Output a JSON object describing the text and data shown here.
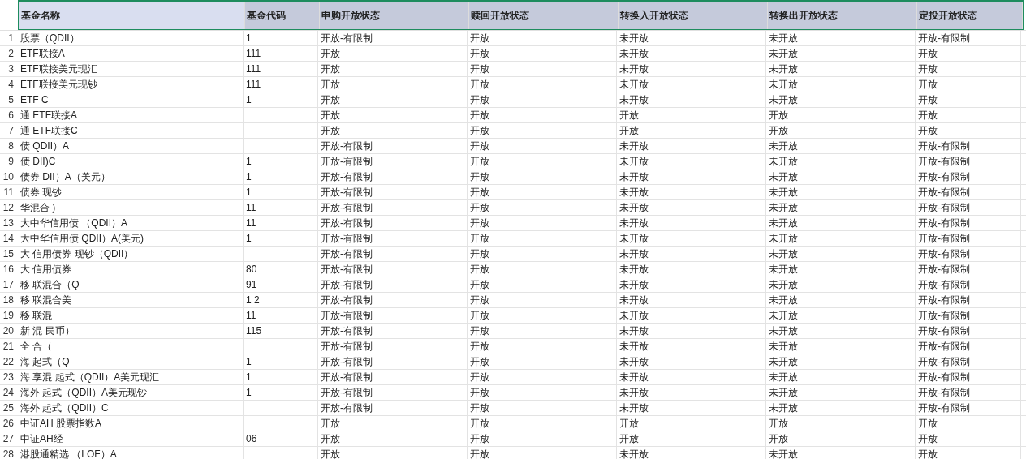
{
  "table": {
    "columns": [
      "基金名称",
      "基金代码",
      "申购开放状态",
      "赎回开放状态",
      "转换入开放状态",
      "转换出开放状态",
      "定投开放状态"
    ],
    "rows": [
      {
        "num": "1",
        "cells": [
          "股票（QDII）",
          "1",
          "开放-有限制",
          "开放",
          "未开放",
          "未开放",
          "开放-有限制"
        ]
      },
      {
        "num": "2",
        "cells": [
          "ETF联接A",
          "111",
          "开放",
          "开放",
          "未开放",
          "未开放",
          "开放"
        ]
      },
      {
        "num": "3",
        "cells": [
          "ETF联接美元现汇",
          "111",
          "开放",
          "开放",
          "未开放",
          "未开放",
          "开放"
        ]
      },
      {
        "num": "4",
        "cells": [
          "ETF联接美元现钞",
          "111",
          "开放",
          "开放",
          "未开放",
          "未开放",
          "开放"
        ]
      },
      {
        "num": "5",
        "cells": [
          "ETF C",
          "1",
          "开放",
          "开放",
          "未开放",
          "未开放",
          "开放"
        ]
      },
      {
        "num": "6",
        "cells": [
          "通 ETF联接A",
          "",
          "开放",
          "开放",
          "开放",
          "开放",
          "开放"
        ]
      },
      {
        "num": "7",
        "cells": [
          "通 ETF联接C",
          "",
          "开放",
          "开放",
          "开放",
          "开放",
          "开放"
        ]
      },
      {
        "num": "8",
        "cells": [
          "债 QDII）A",
          "",
          "开放-有限制",
          "开放",
          "未开放",
          "未开放",
          "开放-有限制"
        ]
      },
      {
        "num": "9",
        "cells": [
          "债 DII)C",
          "1",
          "开放-有限制",
          "开放",
          "未开放",
          "未开放",
          "开放-有限制"
        ]
      },
      {
        "num": "10",
        "cells": [
          "债券 DII）A（美元）",
          "1",
          "开放-有限制",
          "开放",
          "未开放",
          "未开放",
          "开放-有限制"
        ]
      },
      {
        "num": "11",
        "cells": [
          "债券 现钞",
          "1",
          "开放-有限制",
          "开放",
          "未开放",
          "未开放",
          "开放-有限制"
        ]
      },
      {
        "num": "12",
        "cells": [
          "华混合 )",
          "11",
          "开放-有限制",
          "开放",
          "未开放",
          "未开放",
          "开放-有限制"
        ]
      },
      {
        "num": "13",
        "cells": [
          "大中华信用债 （QDII）A",
          "11",
          "开放-有限制",
          "开放",
          "未开放",
          "未开放",
          "开放-有限制"
        ]
      },
      {
        "num": "14",
        "cells": [
          "大中华信用债 QDII）A(美元)",
          "1",
          "开放-有限制",
          "开放",
          "未开放",
          "未开放",
          "开放-有限制"
        ]
      },
      {
        "num": "15",
        "cells": [
          "大 信用债券 现钞（QDII）",
          "",
          "开放-有限制",
          "开放",
          "未开放",
          "未开放",
          "开放-有限制"
        ]
      },
      {
        "num": "16",
        "cells": [
          "大 信用债券",
          "80",
          "开放-有限制",
          "开放",
          "未开放",
          "未开放",
          "开放-有限制"
        ]
      },
      {
        "num": "17",
        "cells": [
          "移 联混合（Q",
          "91",
          "开放-有限制",
          "开放",
          "未开放",
          "未开放",
          "开放-有限制"
        ]
      },
      {
        "num": "18",
        "cells": [
          "移 联混合美",
          "1 2",
          "开放-有限制",
          "开放",
          "未开放",
          "未开放",
          "开放-有限制"
        ]
      },
      {
        "num": "19",
        "cells": [
          "移 联混",
          "11",
          "开放-有限制",
          "开放",
          "未开放",
          "未开放",
          "开放-有限制"
        ]
      },
      {
        "num": "20",
        "cells": [
          "新 混 民币）",
          "115",
          "开放-有限制",
          "开放",
          "未开放",
          "未开放",
          "开放-有限制"
        ]
      },
      {
        "num": "21",
        "cells": [
          "全 合（",
          "",
          "开放-有限制",
          "开放",
          "未开放",
          "未开放",
          "开放-有限制"
        ]
      },
      {
        "num": "22",
        "cells": [
          "海 起式（Q",
          "1",
          "开放-有限制",
          "开放",
          "未开放",
          "未开放",
          "开放-有限制"
        ]
      },
      {
        "num": "23",
        "cells": [
          "海 享混 起式（QDII）A美元现汇",
          "1",
          "开放-有限制",
          "开放",
          "未开放",
          "未开放",
          "开放-有限制"
        ]
      },
      {
        "num": "24",
        "cells": [
          "海外 起式（QDII）A美元现钞",
          "1",
          "开放-有限制",
          "开放",
          "未开放",
          "未开放",
          "开放-有限制"
        ]
      },
      {
        "num": "25",
        "cells": [
          "海外 起式（QDII）C",
          "",
          "开放-有限制",
          "开放",
          "未开放",
          "未开放",
          "开放-有限制"
        ]
      },
      {
        "num": "26",
        "cells": [
          "中证AH 股票指数A",
          "",
          "开放",
          "开放",
          "开放",
          "开放",
          "开放"
        ]
      },
      {
        "num": "27",
        "cells": [
          "中证AH经",
          "06",
          "开放",
          "开放",
          "开放",
          "开放",
          "开放"
        ]
      },
      {
        "num": "28",
        "cells": [
          "港股通精选 （LOF）A",
          "",
          "开放",
          "开放",
          "未开放",
          "未开放",
          "开放"
        ]
      }
    ]
  }
}
